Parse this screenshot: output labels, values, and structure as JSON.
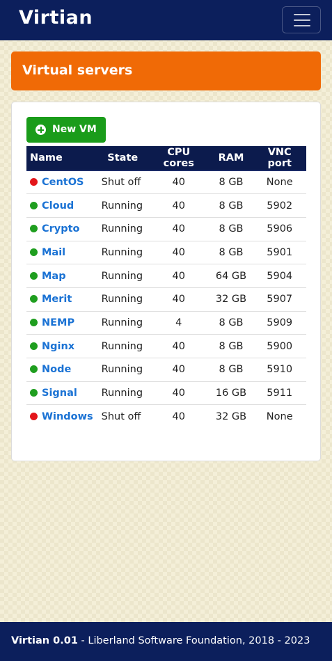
{
  "navbar": {
    "brand": "Virtian",
    "menu_icon": "hamburger-menu-icon"
  },
  "banner": {
    "title": "Virtual servers"
  },
  "toolbar": {
    "new_vm_label": "New VM",
    "new_vm_icon": "plus-circle-icon"
  },
  "table": {
    "headers": {
      "name": "Name",
      "state": "State",
      "cpu": "CPU cores",
      "ram": "RAM",
      "vnc": "VNC port"
    },
    "rows": [
      {
        "name": "CentOS",
        "state": "Shut off",
        "cpu": "40",
        "ram": "8 GB",
        "vnc": "None",
        "status": "stopped"
      },
      {
        "name": "Cloud",
        "state": "Running",
        "cpu": "40",
        "ram": "8 GB",
        "vnc": "5902",
        "status": "running"
      },
      {
        "name": "Crypto",
        "state": "Running",
        "cpu": "40",
        "ram": "8 GB",
        "vnc": "5906",
        "status": "running"
      },
      {
        "name": "Mail",
        "state": "Running",
        "cpu": "40",
        "ram": "8 GB",
        "vnc": "5901",
        "status": "running"
      },
      {
        "name": "Map",
        "state": "Running",
        "cpu": "40",
        "ram": "64 GB",
        "vnc": "5904",
        "status": "running"
      },
      {
        "name": "Merit",
        "state": "Running",
        "cpu": "40",
        "ram": "32 GB",
        "vnc": "5907",
        "status": "running"
      },
      {
        "name": "NEMP",
        "state": "Running",
        "cpu": "4",
        "ram": "8 GB",
        "vnc": "5909",
        "status": "running"
      },
      {
        "name": "Nginx",
        "state": "Running",
        "cpu": "40",
        "ram": "8 GB",
        "vnc": "5900",
        "status": "running"
      },
      {
        "name": "Node",
        "state": "Running",
        "cpu": "40",
        "ram": "8 GB",
        "vnc": "5910",
        "status": "running"
      },
      {
        "name": "Signal",
        "state": "Running",
        "cpu": "40",
        "ram": "16 GB",
        "vnc": "5911",
        "status": "running"
      },
      {
        "name": "Windows",
        "state": "Shut off",
        "cpu": "40",
        "ram": "32 GB",
        "vnc": "None",
        "status": "stopped"
      }
    ]
  },
  "status_colors": {
    "running": "#1f9e1f",
    "stopped": "#e3151a"
  },
  "colors": {
    "navbar": "#0c1f5c",
    "banner": "#f06a06",
    "button": "#1a9c1a",
    "link": "#1a72d4"
  },
  "footer": {
    "app_version": "Virtian 0.01",
    "credit": " - Liberland Software Foundation, 2018 - 2023"
  }
}
